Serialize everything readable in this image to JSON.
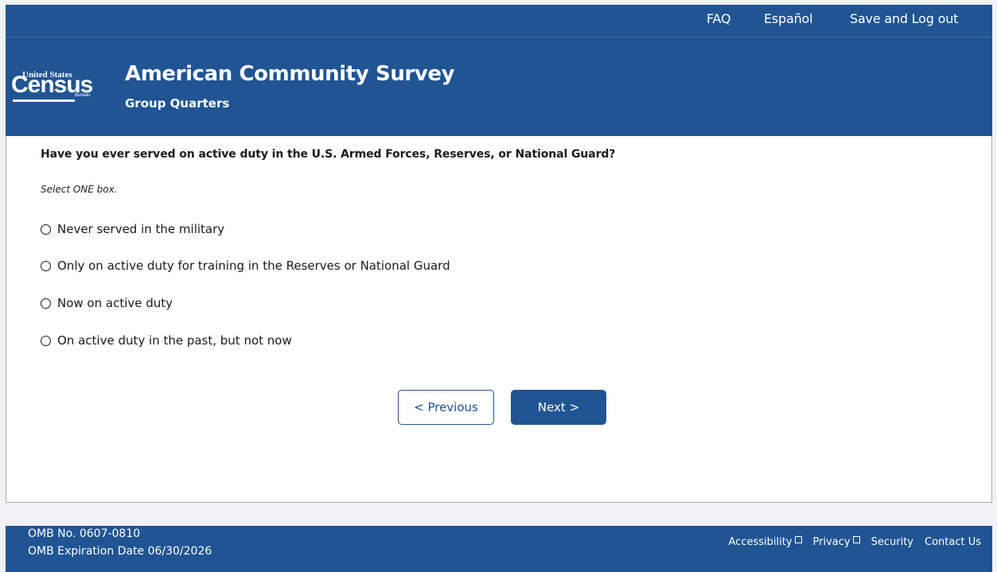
{
  "header": {
    "nav": {
      "faq": "FAQ",
      "espanol": "Español",
      "save_logout": "Save and Log out"
    },
    "logo": {
      "small_text": "United States",
      "big_text": "Census",
      "bureau_text": "Bureau"
    },
    "title": "American Community Survey",
    "subtitle": "Group Quarters"
  },
  "main": {
    "question": "Have you ever served on active duty in the U.S. Armed Forces, Reserves, or National Guard?",
    "instruction": "Select ONE box.",
    "options": [
      {
        "label": "Never served in the military",
        "selected": false
      },
      {
        "label": "Only on active duty for training in the Reserves or National Guard",
        "selected": false
      },
      {
        "label": "Now on active duty",
        "selected": false
      },
      {
        "label": "On active duty in the past, but not now",
        "selected": false
      }
    ],
    "previous_label": "< Previous",
    "next_label": "Next >"
  },
  "footer": {
    "omb_number": "OMB No. 0607-0810",
    "omb_expiration": "OMB Expiration Date 06/30/2026",
    "links": {
      "accessibility": "Accessibility",
      "privacy": "Privacy",
      "security": "Security",
      "contact": "Contact Us"
    }
  },
  "colors": {
    "brand_blue": "#205493",
    "page_background": "#f0f2f4",
    "text": "#1a1a1a"
  },
  "icons": {
    "external_link": "external-link-icon",
    "radio": "radio-unselected-icon"
  }
}
